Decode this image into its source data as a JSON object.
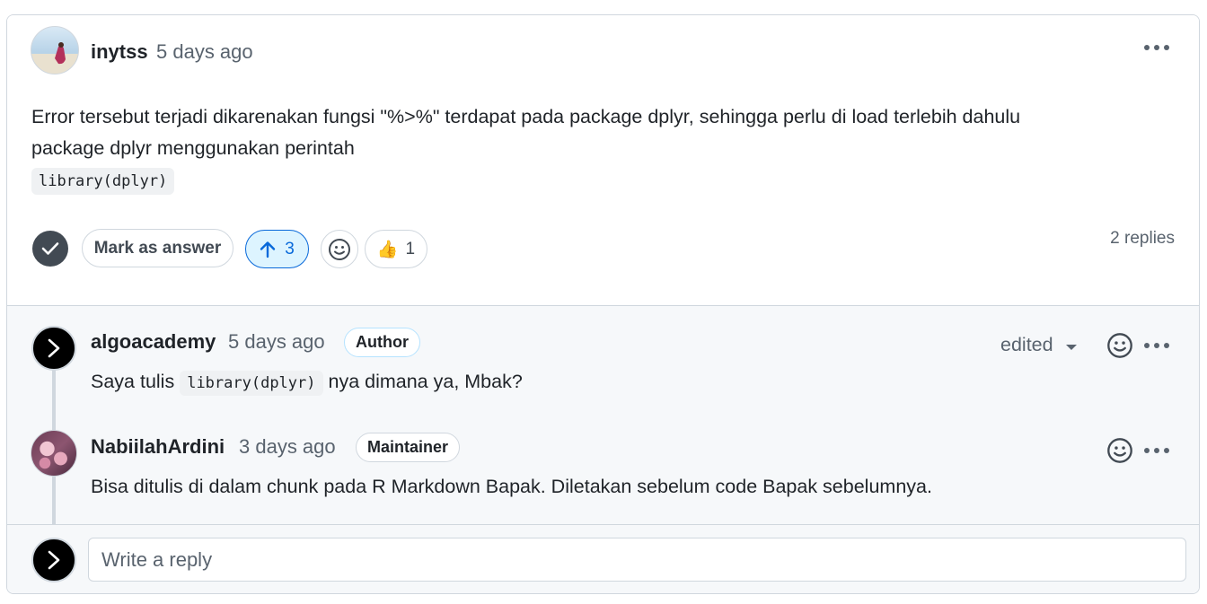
{
  "main_comment": {
    "author": "inytss",
    "time": "5 days ago",
    "body_line1": "Error tersebut terjadi dikarenakan fungsi \"%>%\" terdapat pada package dplyr, sehingga perlu di load terlebih dahulu",
    "body_line2": "package dplyr menggunakan perintah",
    "code": "library(dplyr)",
    "mark_answer_label": "Mark as answer",
    "upvote_count": "3",
    "thumbs_emoji": "👍",
    "thumbs_count": "1",
    "replies_count": "2 replies"
  },
  "replies": [
    {
      "author": "algoacademy",
      "time": "5 days ago",
      "badge": "Author",
      "edited_label": "edited",
      "text_before": "Saya tulis",
      "code": "library(dplyr)",
      "text_after": "nya dimana ya, Mbak?"
    },
    {
      "author": "NabiilahArdini",
      "time": "3 days ago",
      "badge": "Maintainer",
      "text": "Bisa ditulis di dalam chunk pada R Markdown Bapak. Diletakan sebelum code Bapak sebelumnya."
    }
  ],
  "reply_input": {
    "placeholder": "Write a reply"
  },
  "colors": {
    "accent": "#0969da",
    "upvote_bg": "#ddf4ff",
    "reply_bg": "#f6f8fa",
    "border": "#d0d7de",
    "muted": "#59636e"
  },
  "icons": [
    "check-icon",
    "arrow-up-icon",
    "smiley-icon",
    "kebab-icon",
    "caret-down-icon",
    "chevron-right-icon"
  ]
}
